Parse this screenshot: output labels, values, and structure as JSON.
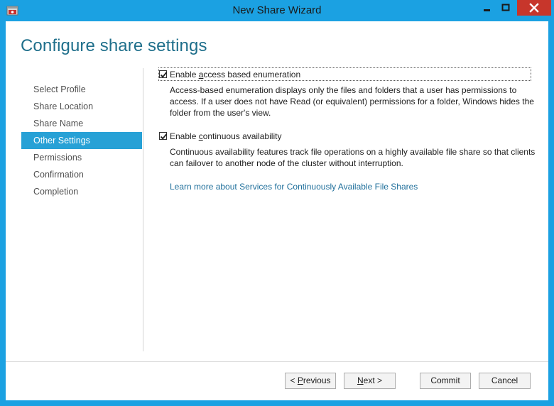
{
  "window": {
    "title": "New Share Wizard",
    "accent_color": "#1ba1e2",
    "close_color": "#c7362b"
  },
  "page": {
    "title": "Configure share settings"
  },
  "nav": {
    "items": [
      {
        "label": "Select Profile",
        "active": false
      },
      {
        "label": "Share Location",
        "active": false
      },
      {
        "label": "Share Name",
        "active": false
      },
      {
        "label": "Other Settings",
        "active": true
      },
      {
        "label": "Permissions",
        "active": false
      },
      {
        "label": "Confirmation",
        "active": false
      },
      {
        "label": "Completion",
        "active": false
      }
    ]
  },
  "options": {
    "abe": {
      "label_pre": "Enable ",
      "label_underlined": "a",
      "label_post": "ccess based enumeration",
      "checked": true,
      "description": "Access-based enumeration displays only the files and folders that a user has permissions to access. If a user does not have Read (or equivalent) permissions for a folder, Windows hides the folder from the user's view."
    },
    "ca": {
      "label_pre": "Enable ",
      "label_underlined": "c",
      "label_post": "ontinuous availability",
      "checked": true,
      "description": "Continuous availability features track file operations on a highly available file share so that clients can failover to another node of the cluster without interruption."
    },
    "learn_more_link": "Learn more about Services for Continuously Available File Shares"
  },
  "buttons": {
    "previous_pre": "< ",
    "previous_u": "P",
    "previous_post": "revious",
    "next_u": "N",
    "next_post": "ext >",
    "commit": "Commit",
    "cancel": "Cancel"
  }
}
